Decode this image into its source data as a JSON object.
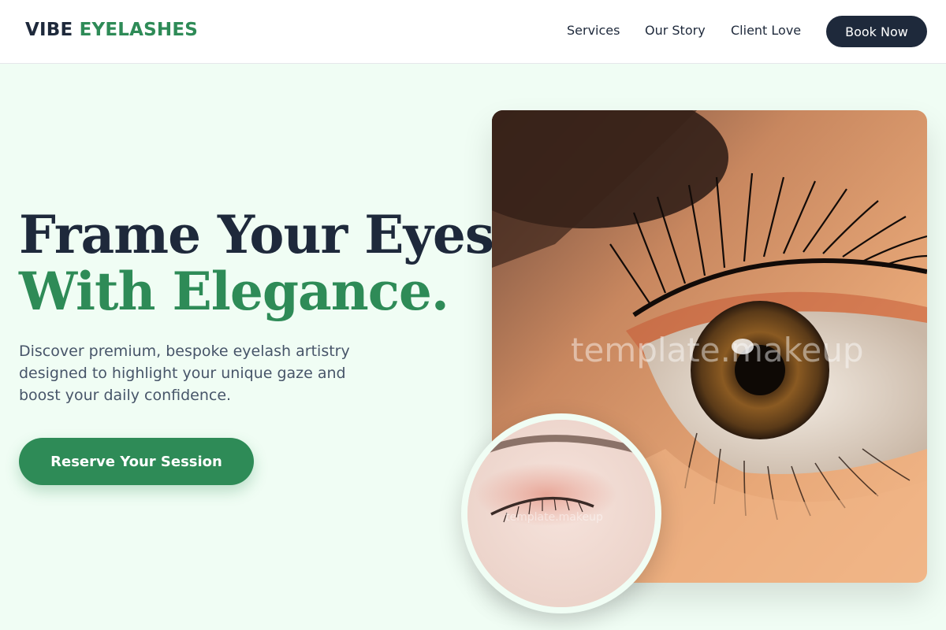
{
  "brand": {
    "part1": "VIBE",
    "part2": "EYELASHES"
  },
  "nav": {
    "links": [
      {
        "label": "Services"
      },
      {
        "label": "Our Story"
      },
      {
        "label": "Client Love"
      }
    ],
    "cta_label": "Book Now"
  },
  "hero": {
    "title_line1": "Frame Your Eyes",
    "title_line2": "With Elegance.",
    "description": "Discover premium, bespoke eyelash artistry designed to highlight your unique gaze and boost your daily confidence.",
    "cta_label": "Reserve Your Session"
  },
  "images": {
    "main_watermark": "template.makeup",
    "inset_watermark": "template.makeup"
  },
  "colors": {
    "background": "#f0fdf4",
    "primary_dark": "#1e293b",
    "accent_green": "#2e8b57",
    "body_text": "#475569"
  }
}
